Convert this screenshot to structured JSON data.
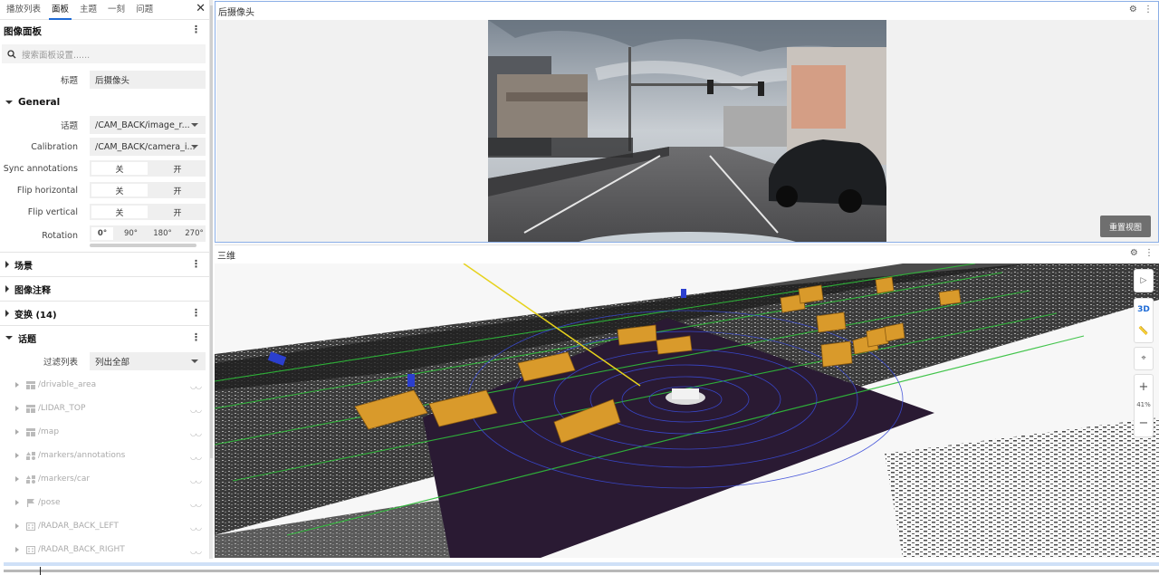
{
  "sidebar": {
    "tabs": [
      {
        "label": "播放列表",
        "active": false
      },
      {
        "label": "面板",
        "active": true
      },
      {
        "label": "主题",
        "active": false
      },
      {
        "label": "一刻",
        "active": false
      },
      {
        "label": "问题",
        "active": false
      }
    ],
    "close_icon": "close-icon",
    "panel_title": "图像面板",
    "search_placeholder": "搜索面板设置......",
    "title_label": "标题",
    "title_value": "后摄像头",
    "general": {
      "heading": "General",
      "topic_label": "话题",
      "topic_value": "/CAM_BACK/image_r...",
      "calibration_label": "Calibration",
      "calibration_value": "/CAM_BACK/camera_i...",
      "sync_label": "Sync annotations",
      "flip_h_label": "Flip horizontal",
      "flip_v_label": "Flip vertical",
      "off": "关",
      "on": "开",
      "rotation_label": "Rotation",
      "rotation_options": [
        "0°",
        "90°",
        "180°",
        "270°"
      ]
    },
    "groups": [
      {
        "label": "场景",
        "expanded": false,
        "menu": true
      },
      {
        "label": "图像注释",
        "expanded": false,
        "menu": false
      },
      {
        "label": "变换 (14)",
        "expanded": false,
        "menu": true
      },
      {
        "label": "话题",
        "expanded": true,
        "menu": true
      }
    ],
    "filter_label": "过滤列表",
    "filter_value": "列出全部",
    "topics": [
      {
        "label": "/drivable_area",
        "icon": "grid-icon"
      },
      {
        "label": "/LIDAR_TOP",
        "icon": "grid-icon"
      },
      {
        "label": "/map",
        "icon": "grid-icon"
      },
      {
        "label": "/markers/annotations",
        "icon": "shapes-icon"
      },
      {
        "label": "/markers/car",
        "icon": "shapes-icon"
      },
      {
        "label": "/pose",
        "icon": "flag-icon"
      },
      {
        "label": "/RADAR_BACK_LEFT",
        "icon": "dots-icon"
      },
      {
        "label": "/RADAR_BACK_RIGHT",
        "icon": "dots-icon"
      }
    ]
  },
  "image_panel": {
    "title": "后摄像头",
    "reset_label": "重置视图"
  },
  "scene_panel": {
    "title": "三维",
    "mode_label": "3D",
    "zoom_label": "41%"
  },
  "colors": {
    "accent": "#1e6bd6",
    "box": "#d99a2b",
    "lidar": "#3a4bd8"
  }
}
